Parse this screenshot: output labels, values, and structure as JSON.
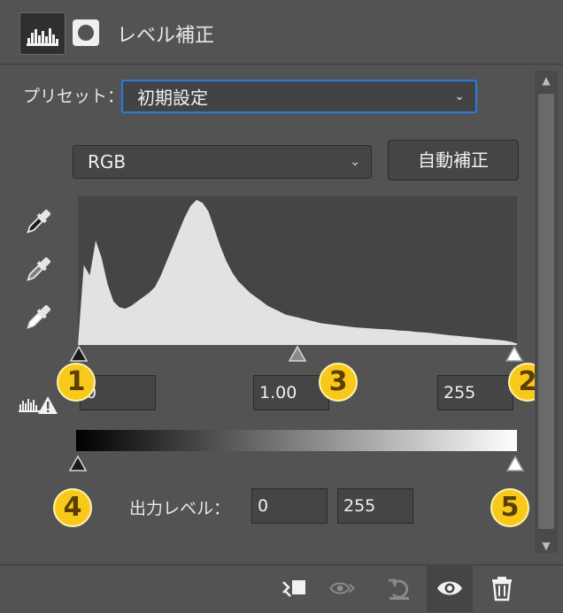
{
  "panel": {
    "title": "レベル補正",
    "tabs": [
      {
        "name": "adjustment-tab",
        "icon": "histogram-icon"
      },
      {
        "name": "mask-tab",
        "icon": "mask-icon"
      }
    ]
  },
  "preset": {
    "label": "プリセット：",
    "value": "初期設定"
  },
  "channel": {
    "value": "RGB"
  },
  "auto_button": "自動補正",
  "input_levels": {
    "black": "0",
    "gamma": "1.00",
    "white": "255"
  },
  "output_levels": {
    "label": "出力レベル：",
    "black": "0",
    "white": "255"
  },
  "annotations": [
    "1",
    "2",
    "3",
    "4",
    "5"
  ],
  "histogram": {
    "values": [
      0,
      0.55,
      0.48,
      0.72,
      0.6,
      0.42,
      0.3,
      0.26,
      0.25,
      0.27,
      0.3,
      0.33,
      0.36,
      0.4,
      0.48,
      0.58,
      0.68,
      0.78,
      0.88,
      0.96,
      1.0,
      0.98,
      0.92,
      0.8,
      0.68,
      0.58,
      0.5,
      0.44,
      0.4,
      0.36,
      0.33,
      0.3,
      0.27,
      0.25,
      0.23,
      0.21,
      0.2,
      0.19,
      0.18,
      0.17,
      0.16,
      0.15,
      0.145,
      0.14,
      0.135,
      0.13,
      0.125,
      0.12,
      0.118,
      0.115,
      0.112,
      0.11,
      0.108,
      0.105,
      0.1,
      0.098,
      0.095,
      0.09,
      0.088,
      0.085,
      0.08,
      0.075,
      0.07,
      0.066,
      0.062,
      0.058,
      0.055,
      0.05,
      0.046,
      0.042,
      0.038,
      0.034,
      0.03,
      0.022,
      0.01
    ]
  },
  "colors": {
    "panel_bg": "#535353",
    "field_bg": "#454545",
    "focus_blue": "#2c7be5",
    "badge_yellow": "#f8c81b"
  },
  "footer_icons": [
    "clip-to-layer-icon",
    "view-previous-state-icon",
    "reset-icon",
    "visibility-eye-icon",
    "trash-icon"
  ]
}
